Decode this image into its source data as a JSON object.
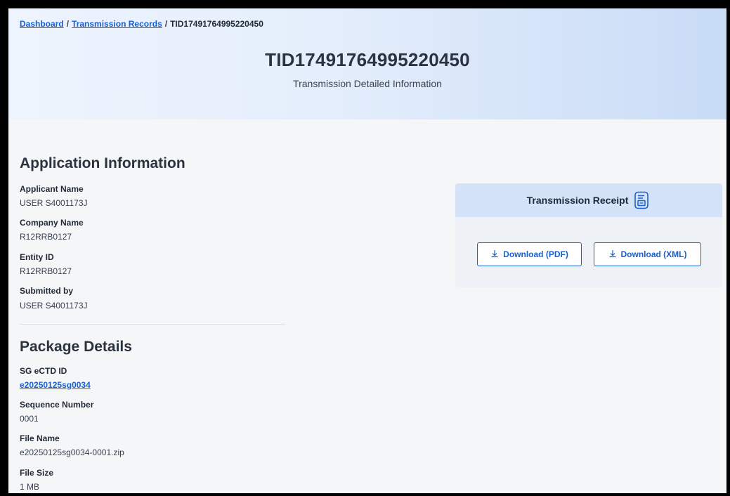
{
  "breadcrumb": {
    "items": [
      {
        "label": "Dashboard"
      },
      {
        "label": "Transmission Records"
      }
    ],
    "current": "TID17491764995220450",
    "separator": "/"
  },
  "header": {
    "title": "TID17491764995220450",
    "subtitle": "Transmission Detailed Information"
  },
  "application_info": {
    "heading": "Application Information",
    "fields": [
      {
        "label": "Applicant Name",
        "value": "USER S4001173J"
      },
      {
        "label": "Company Name",
        "value": "R12RRB0127"
      },
      {
        "label": "Entity ID",
        "value": "R12RRB0127"
      },
      {
        "label": "Submitted by",
        "value": "USER S4001173J"
      }
    ]
  },
  "package_details": {
    "heading": "Package Details",
    "fields": [
      {
        "label": "SG eCTD ID",
        "value": "e20250125sg0034"
      },
      {
        "label": "Sequence Number",
        "value": "0001"
      },
      {
        "label": "File Name",
        "value": "e20250125sg0034-0001.zip"
      },
      {
        "label": "File Size",
        "value": "1 MB"
      }
    ]
  },
  "receipt": {
    "title": "Transmission Receipt",
    "icon": "receipt-document-icon",
    "download_pdf_label": "Download (PDF)",
    "download_xml_label": "Download (XML)"
  },
  "colors": {
    "accent": "#1a5fd0",
    "receipt_header": "#d5e3f9",
    "background": "#f5f6f8"
  }
}
